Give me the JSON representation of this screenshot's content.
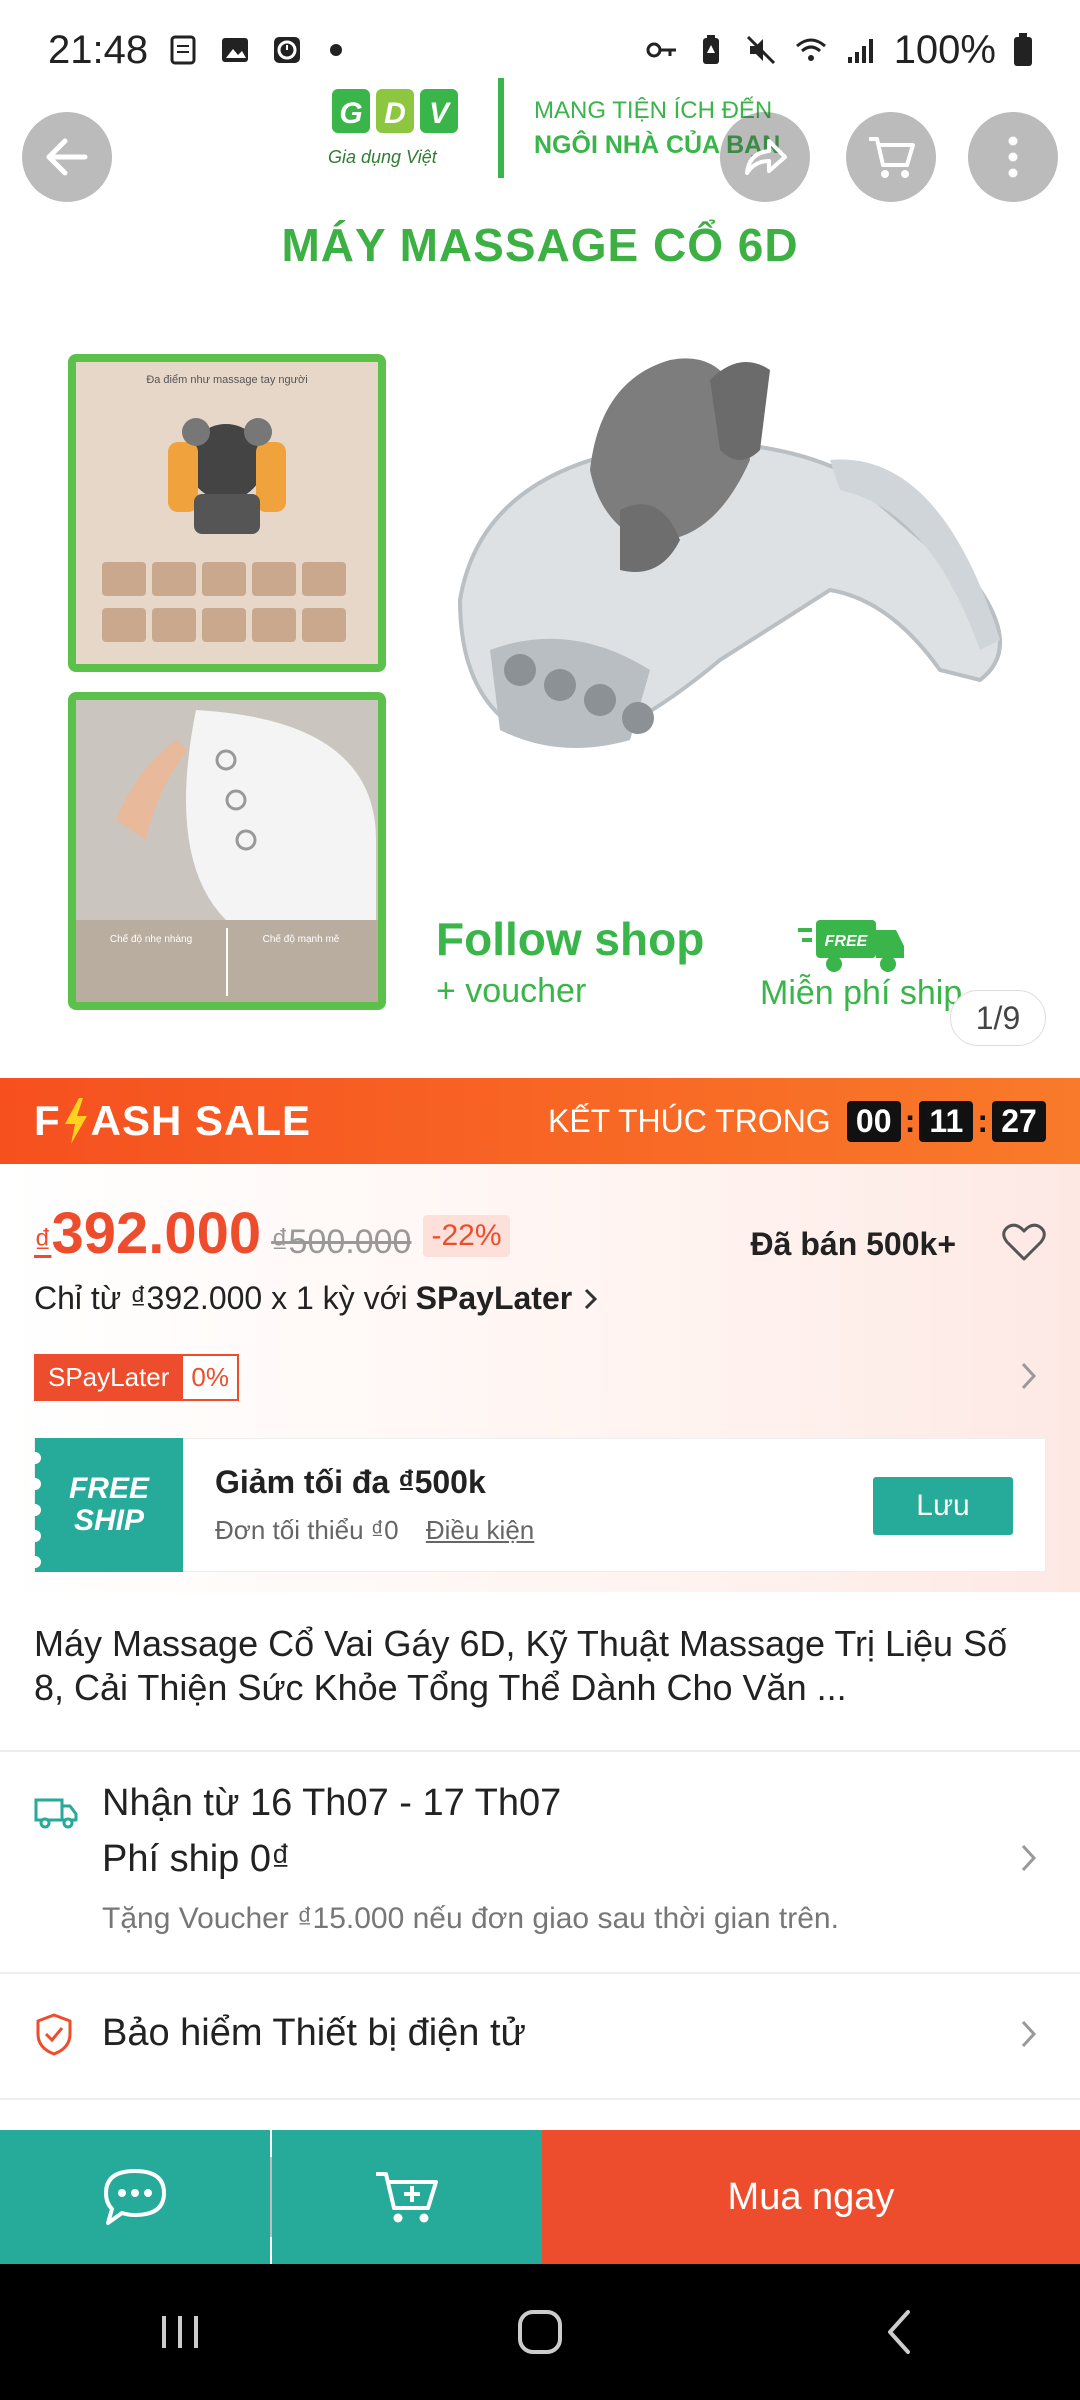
{
  "status_bar": {
    "time": "21:48",
    "battery": "100%"
  },
  "hero": {
    "brand_abbrev": "GDV",
    "brand_name": "Gia dụng Việt",
    "brand_tag_line1": "MANG TIỆN ÍCH ĐẾN",
    "brand_tag_line2": "NGÔI NHÀ CỦA BẠN",
    "title": "MÁY MASSAGE CỔ 6D",
    "panel1_caption": "Đa điểm như massage tay người",
    "panel2_caption_left": "Chế độ nhẹ nhàng",
    "panel2_caption_right": "Chế độ mạnh mẽ",
    "follow_shop": "Follow shop",
    "voucher": "+ voucher",
    "free_badge": "FREE",
    "free_ship": "Miễn phí ship",
    "image_counter": "1/9"
  },
  "flash_sale": {
    "title_prefix": "F",
    "title_suffix": "ASH SALE",
    "ends_label": "KẾT THÚC TRONG",
    "hours": "00",
    "minutes": "11",
    "seconds": "27"
  },
  "price": {
    "currency": "₫",
    "value": "392.000",
    "old_price": "₫500.000",
    "discount": "-22%",
    "sold": "Đã bán 500k+",
    "installment_text": "Chỉ từ ₫392.000 x 1 kỳ với",
    "installment_brand": "SPayLater",
    "spay_badge": "SPayLater",
    "spay_pct": "0%"
  },
  "voucher_card": {
    "stub_line1": "FREE",
    "stub_line2": "SHIP",
    "title": "Giảm tối đa ₫500k",
    "min_order": "Đơn tối thiểu ₫0",
    "conditions": "Điều kiện",
    "save_label": "Lưu"
  },
  "product": {
    "title": "Máy Massage Cổ Vai Gáy 6D, Kỹ Thuật Massage Trị Liệu Số 8, Cải Thiện Sức Khỏe Tổng Thể Dành Cho Văn ..."
  },
  "shipping": {
    "date": "Nhận từ 16 Th07 - 17 Th07",
    "fee": "Phí ship 0₫",
    "note": "Tặng Voucher ₫15.000 nếu đơn giao sau thời gian trên."
  },
  "insurance": {
    "label": "Bảo hiểm Thiết bị điện tử"
  },
  "action_bar": {
    "buy_now": "Mua ngay"
  },
  "colors": {
    "brand_green": "#39b54a",
    "shopee_orange": "#ee4d2d",
    "teal": "#26aa99"
  }
}
